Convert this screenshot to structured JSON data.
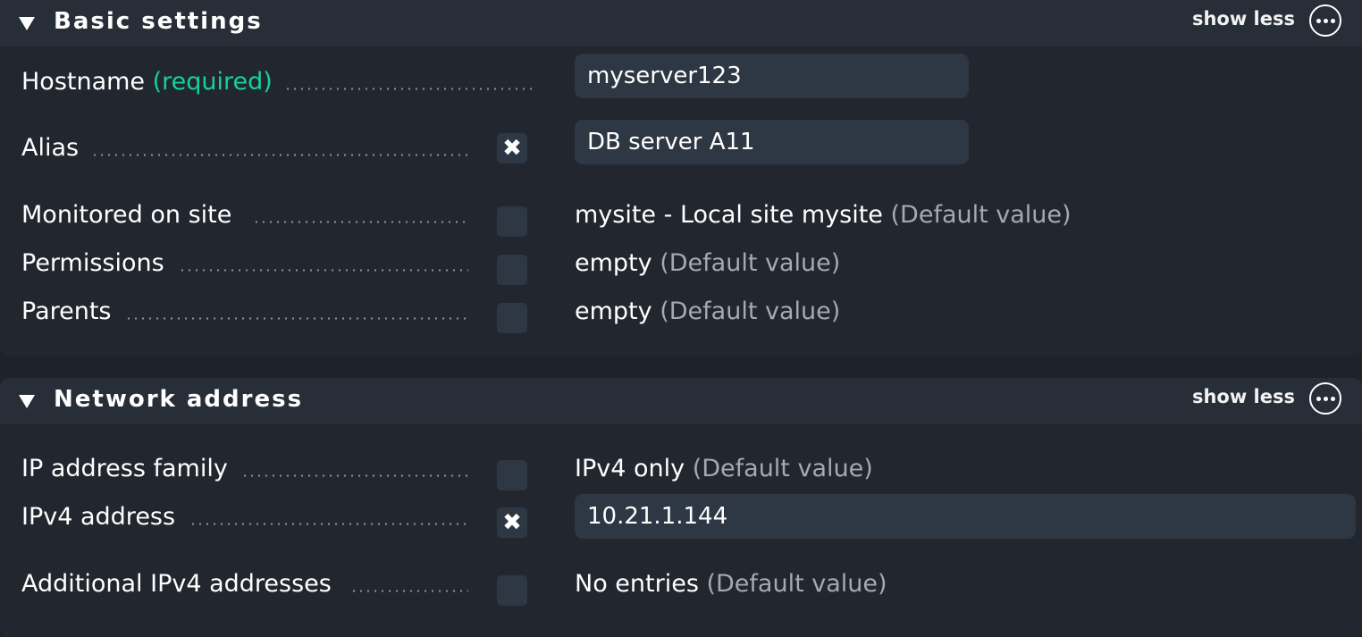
{
  "sections": {
    "basic": {
      "title": "Basic settings",
      "show_less_label": "show less",
      "rows": {
        "hostname": {
          "label": "Hostname",
          "required_label": "(required)",
          "value": "myserver123"
        },
        "alias": {
          "label": "Alias",
          "checked": true,
          "check_glyph": "✖",
          "value": "DB server A11"
        },
        "monitored_on_site": {
          "label": "Monitored on site",
          "checked": false,
          "value": "mysite - Local site mysite",
          "default_note": "(Default value)"
        },
        "permissions": {
          "label": "Permissions",
          "checked": false,
          "value": "empty",
          "default_note": "(Default value)"
        },
        "parents": {
          "label": "Parents",
          "checked": false,
          "value": "empty",
          "default_note": "(Default value)"
        }
      }
    },
    "network": {
      "title": "Network address",
      "show_less_label": "show less",
      "rows": {
        "ip_family": {
          "label": "IP address family",
          "checked": false,
          "value": "IPv4 only",
          "default_note": "(Default value)"
        },
        "ipv4_address": {
          "label": "IPv4 address",
          "checked": true,
          "check_glyph": "✖",
          "value": "10.21.1.144"
        },
        "additional_ipv4": {
          "label": "Additional IPv4 addresses",
          "checked": false,
          "value": "No entries",
          "default_note": "(Default value)"
        }
      }
    }
  },
  "icons": {
    "collapse": "triangle-down-icon",
    "more": "more-options-icon",
    "checkbox_checked": "cross-icon"
  },
  "colors": {
    "required": "#15d1a0",
    "default_note": "#a5a9b0",
    "section_bg": "#21262f",
    "header_bg": "#282e38",
    "field_bg": "#2e3744"
  }
}
